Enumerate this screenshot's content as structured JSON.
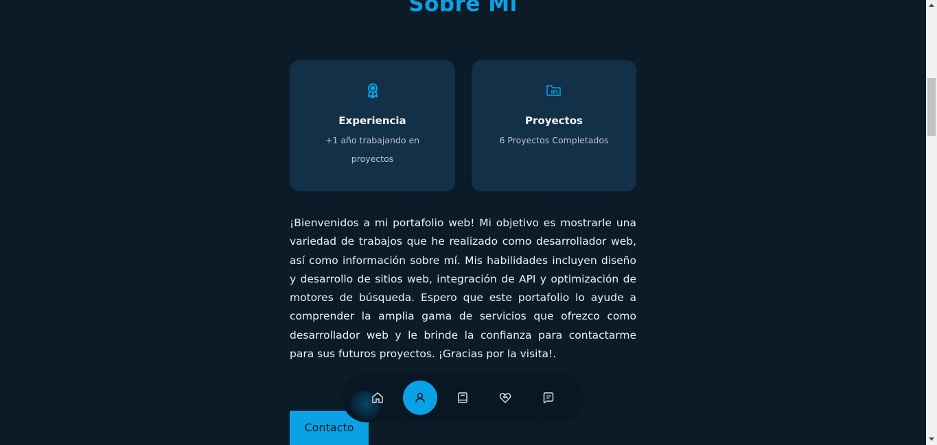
{
  "section": {
    "title": "Sobre Mí"
  },
  "cards": [
    {
      "icon": "award-icon",
      "title": "Experiencia",
      "text": "+1 año trabajando en proyectos"
    },
    {
      "icon": "folder-library-icon",
      "title": "Proyectos",
      "text": "6 Proyectos Completados"
    }
  ],
  "about": {
    "text": "¡Bienvenidos a mi portafolio web! Mi objetivo es mostrarle una variedad de trabajos que he realizado como desarrollador web, así como información sobre mí. Mis habilidades incluyen diseño y desarrollo de sitios web, integración de API y optimización de motores de búsqueda. Espero que este portafolio lo ayude a comprender la amplia gama de servicios que ofrezco como desarrollador web y le brinde la confianza para contactarme para sus futuros proyectos. ¡Gracias por la visita!.",
    "contact_button": "Contacto"
  },
  "nav": {
    "items": [
      {
        "icon": "home-icon",
        "active": false
      },
      {
        "icon": "user-icon",
        "active": true
      },
      {
        "icon": "book-icon",
        "active": false
      },
      {
        "icon": "heart-handshake-icon",
        "active": false
      },
      {
        "icon": "message-icon",
        "active": false
      }
    ]
  },
  "colors": {
    "accent": "#0aa2e4",
    "background": "#0b1a27",
    "card": "#133049",
    "nav": "#081723"
  }
}
